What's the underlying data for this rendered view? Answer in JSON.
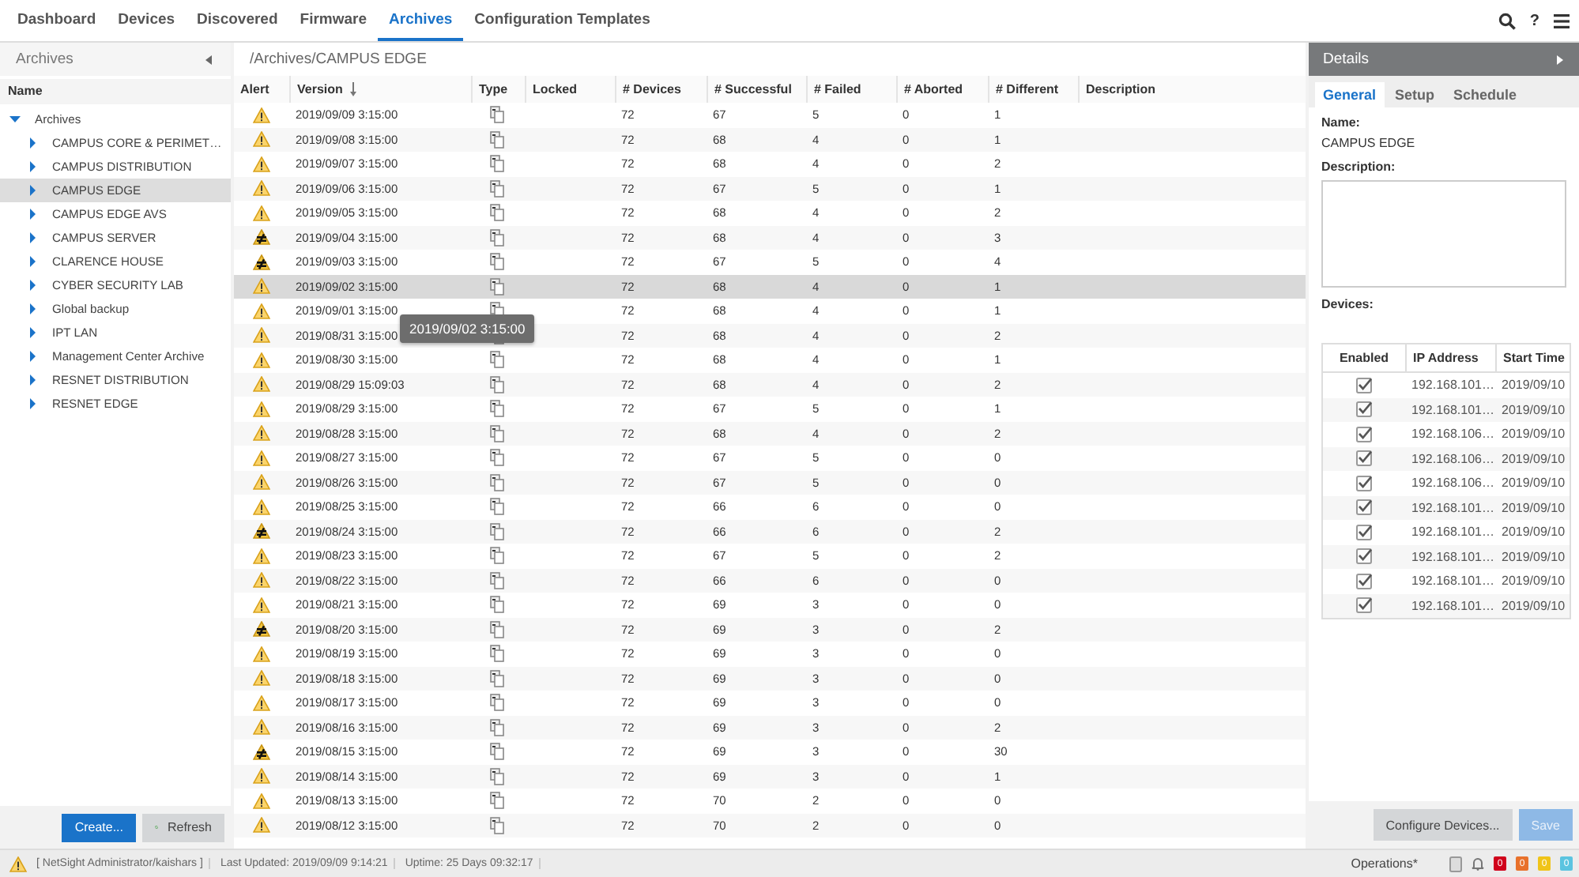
{
  "nav": {
    "tabs": [
      {
        "label": "Dashboard",
        "selected": false
      },
      {
        "label": "Devices",
        "selected": false
      },
      {
        "label": "Discovered",
        "selected": false
      },
      {
        "label": "Firmware",
        "selected": false
      },
      {
        "label": "Archives",
        "selected": true
      },
      {
        "label": "Configuration Templates",
        "selected": false
      }
    ],
    "help": "?"
  },
  "archives_panel": {
    "title": "Archives",
    "column": "Name",
    "tree": [
      {
        "label": "Archives",
        "expanded": true,
        "selected": false,
        "children": [
          {
            "label": "CAMPUS CORE & PERIMET…",
            "expanded": false,
            "selected": false
          },
          {
            "label": "CAMPUS DISTRIBUTION",
            "expanded": false,
            "selected": false
          },
          {
            "label": "CAMPUS EDGE",
            "expanded": false,
            "selected": true
          },
          {
            "label": "CAMPUS EDGE AVS",
            "expanded": false,
            "selected": false
          },
          {
            "label": "CAMPUS SERVER",
            "expanded": false,
            "selected": false
          },
          {
            "label": "CLARENCE HOUSE",
            "expanded": false,
            "selected": false
          },
          {
            "label": "CYBER SECURITY LAB",
            "expanded": false,
            "selected": false
          },
          {
            "label": "Global backup",
            "expanded": false,
            "selected": false
          },
          {
            "label": "IPT LAN",
            "expanded": false,
            "selected": false
          },
          {
            "label": "Management Center Archive",
            "expanded": false,
            "selected": false
          },
          {
            "label": "RESNET DISTRIBUTION",
            "expanded": false,
            "selected": false
          },
          {
            "label": "RESNET EDGE",
            "expanded": false,
            "selected": false
          }
        ]
      }
    ],
    "buttons": [
      {
        "label": "Create...",
        "kind": "primary"
      },
      {
        "label": "Refresh",
        "kind": "refresh"
      }
    ]
  },
  "archive": {
    "path": "/Archives/CAMPUS EDGE",
    "columns": [
      "Alert",
      "Version",
      "Type",
      "Locked",
      "# Devices",
      "# Successful",
      "# Failed",
      "# Aborted",
      "# Different",
      "Description"
    ],
    "rows": [
      {
        "kind": "warning",
        "version": "2019/09/09 3:15:00",
        "devices": "72",
        "successful": "67",
        "failed": "5",
        "aborted": "0",
        "different": "1",
        "selected": false
      },
      {
        "kind": "warning",
        "version": "2019/09/08 3:15:00",
        "devices": "72",
        "successful": "68",
        "failed": "4",
        "aborted": "0",
        "different": "1",
        "selected": false
      },
      {
        "kind": "warning",
        "version": "2019/09/07 3:15:00",
        "devices": "72",
        "successful": "68",
        "failed": "4",
        "aborted": "0",
        "different": "2",
        "selected": false
      },
      {
        "kind": "warning",
        "version": "2019/09/06 3:15:00",
        "devices": "72",
        "successful": "67",
        "failed": "5",
        "aborted": "0",
        "different": "1",
        "selected": false
      },
      {
        "kind": "warning",
        "version": "2019/09/05 3:15:00",
        "devices": "72",
        "successful": "68",
        "failed": "4",
        "aborted": "0",
        "different": "2",
        "selected": false
      },
      {
        "kind": "changed",
        "version": "2019/09/04 3:15:00",
        "devices": "72",
        "successful": "68",
        "failed": "4",
        "aborted": "0",
        "different": "3",
        "selected": false
      },
      {
        "kind": "changed",
        "version": "2019/09/03 3:15:00",
        "devices": "72",
        "successful": "67",
        "failed": "5",
        "aborted": "0",
        "different": "4",
        "selected": false
      },
      {
        "kind": "warning",
        "version": "2019/09/02 3:15:00",
        "devices": "72",
        "successful": "68",
        "failed": "4",
        "aborted": "0",
        "different": "1",
        "selected": true
      },
      {
        "kind": "warning",
        "version": "2019/09/01 3:15:00",
        "devices": "72",
        "successful": "68",
        "failed": "4",
        "aborted": "0",
        "different": "1",
        "selected": false
      },
      {
        "kind": "warning",
        "version": "2019/08/31 3:15:00",
        "devices": "72",
        "successful": "68",
        "failed": "4",
        "aborted": "0",
        "different": "2",
        "selected": false
      },
      {
        "kind": "warning",
        "version": "2019/08/30 3:15:00",
        "devices": "72",
        "successful": "68",
        "failed": "4",
        "aborted": "0",
        "different": "1",
        "selected": false
      },
      {
        "kind": "warning",
        "version": "2019/08/29 15:09:03",
        "devices": "72",
        "successful": "68",
        "failed": "4",
        "aborted": "0",
        "different": "2",
        "selected": false
      },
      {
        "kind": "warning",
        "version": "2019/08/29 3:15:00",
        "devices": "72",
        "successful": "67",
        "failed": "5",
        "aborted": "0",
        "different": "1",
        "selected": false
      },
      {
        "kind": "warning",
        "version": "2019/08/28 3:15:00",
        "devices": "72",
        "successful": "68",
        "failed": "4",
        "aborted": "0",
        "different": "2",
        "selected": false
      },
      {
        "kind": "warning",
        "version": "2019/08/27 3:15:00",
        "devices": "72",
        "successful": "67",
        "failed": "5",
        "aborted": "0",
        "different": "0",
        "selected": false
      },
      {
        "kind": "warning",
        "version": "2019/08/26 3:15:00",
        "devices": "72",
        "successful": "67",
        "failed": "5",
        "aborted": "0",
        "different": "0",
        "selected": false
      },
      {
        "kind": "warning",
        "version": "2019/08/25 3:15:00",
        "devices": "72",
        "successful": "66",
        "failed": "6",
        "aborted": "0",
        "different": "0",
        "selected": false
      },
      {
        "kind": "changed",
        "version": "2019/08/24 3:15:00",
        "devices": "72",
        "successful": "66",
        "failed": "6",
        "aborted": "0",
        "different": "2",
        "selected": false
      },
      {
        "kind": "warning",
        "version": "2019/08/23 3:15:00",
        "devices": "72",
        "successful": "67",
        "failed": "5",
        "aborted": "0",
        "different": "2",
        "selected": false
      },
      {
        "kind": "warning",
        "version": "2019/08/22 3:15:00",
        "devices": "72",
        "successful": "66",
        "failed": "6",
        "aborted": "0",
        "different": "0",
        "selected": false
      },
      {
        "kind": "warning",
        "version": "2019/08/21 3:15:00",
        "devices": "72",
        "successful": "69",
        "failed": "3",
        "aborted": "0",
        "different": "0",
        "selected": false
      },
      {
        "kind": "changed",
        "version": "2019/08/20 3:15:00",
        "devices": "72",
        "successful": "69",
        "failed": "3",
        "aborted": "0",
        "different": "2",
        "selected": false
      },
      {
        "kind": "warning",
        "version": "2019/08/19 3:15:00",
        "devices": "72",
        "successful": "69",
        "failed": "3",
        "aborted": "0",
        "different": "0",
        "selected": false
      },
      {
        "kind": "warning",
        "version": "2019/08/18 3:15:00",
        "devices": "72",
        "successful": "69",
        "failed": "3",
        "aborted": "0",
        "different": "0",
        "selected": false
      },
      {
        "kind": "warning",
        "version": "2019/08/17 3:15:00",
        "devices": "72",
        "successful": "69",
        "failed": "3",
        "aborted": "0",
        "different": "0",
        "selected": false
      },
      {
        "kind": "warning",
        "version": "2019/08/16 3:15:00",
        "devices": "72",
        "successful": "69",
        "failed": "3",
        "aborted": "0",
        "different": "2",
        "selected": false
      },
      {
        "kind": "changed",
        "version": "2019/08/15 3:15:00",
        "devices": "72",
        "successful": "69",
        "failed": "3",
        "aborted": "0",
        "different": "30",
        "selected": false
      },
      {
        "kind": "warning",
        "version": "2019/08/14 3:15:00",
        "devices": "72",
        "successful": "69",
        "failed": "3",
        "aborted": "0",
        "different": "1",
        "selected": false
      },
      {
        "kind": "warning",
        "version": "2019/08/13 3:15:00",
        "devices": "72",
        "successful": "70",
        "failed": "2",
        "aborted": "0",
        "different": "0",
        "selected": false
      },
      {
        "kind": "warning",
        "version": "2019/08/12 3:15:00",
        "devices": "72",
        "successful": "70",
        "failed": "2",
        "aborted": "0",
        "different": "0",
        "selected": false
      }
    ],
    "tooltip": "2019/09/02 3:15:00"
  },
  "details": {
    "title": "Details",
    "tabs": [
      {
        "label": "General",
        "selected": true
      },
      {
        "label": "Setup",
        "selected": false
      },
      {
        "label": "Schedule",
        "selected": false
      }
    ],
    "name_label": "Name:",
    "name": "CAMPUS EDGE",
    "description_label": "Description:",
    "devices_label": "Devices:",
    "device_columns": [
      "Enabled",
      "IP Address",
      "Start Time"
    ],
    "devices": [
      {
        "enabled": true,
        "ip": "192.168.101…",
        "start": "2019/09/10"
      },
      {
        "enabled": true,
        "ip": "192.168.101…",
        "start": "2019/09/10"
      },
      {
        "enabled": true,
        "ip": "192.168.106…",
        "start": "2019/09/10"
      },
      {
        "enabled": true,
        "ip": "192.168.106…",
        "start": "2019/09/10"
      },
      {
        "enabled": true,
        "ip": "192.168.106…",
        "start": "2019/09/10"
      },
      {
        "enabled": true,
        "ip": "192.168.101…",
        "start": "2019/09/10"
      },
      {
        "enabled": true,
        "ip": "192.168.101…",
        "start": "2019/09/10"
      },
      {
        "enabled": true,
        "ip": "192.168.101…",
        "start": "2019/09/10"
      },
      {
        "enabled": true,
        "ip": "192.168.101…",
        "start": "2019/09/10"
      },
      {
        "enabled": true,
        "ip": "192.168.101…",
        "start": "2019/09/10"
      }
    ],
    "buttons": [
      {
        "label": "Configure Devices...",
        "disabled": false
      },
      {
        "label": "Save",
        "disabled": true
      }
    ]
  },
  "status_bar": {
    "user": "[ NetSight Administrator/kaishars ]",
    "updated": "Last Updated: 2019/09/09 9:14:21",
    "uptime": "Uptime: 25 Days 09:32:17",
    "operations": "Operations*",
    "badges": [
      {
        "text": "0",
        "color": "#d0021b"
      },
      {
        "text": "0",
        "color": "#e8712b"
      },
      {
        "text": "0",
        "color": "#f0c419"
      },
      {
        "text": "0",
        "color": "#5bc4e0"
      }
    ]
  }
}
